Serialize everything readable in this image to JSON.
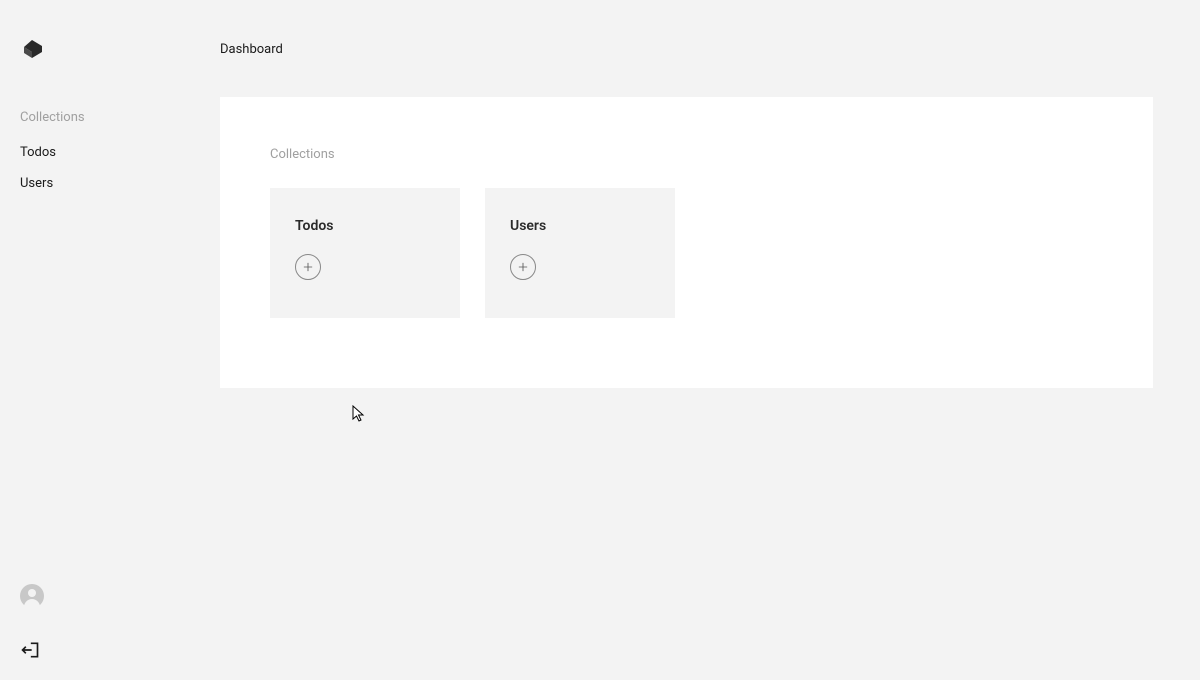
{
  "header": {
    "title": "Dashboard"
  },
  "sidebar": {
    "section_title": "Collections",
    "items": [
      {
        "label": "Todos"
      },
      {
        "label": "Users"
      }
    ]
  },
  "panel": {
    "section_title": "Collections",
    "cards": [
      {
        "title": "Todos"
      },
      {
        "title": "Users"
      }
    ]
  }
}
